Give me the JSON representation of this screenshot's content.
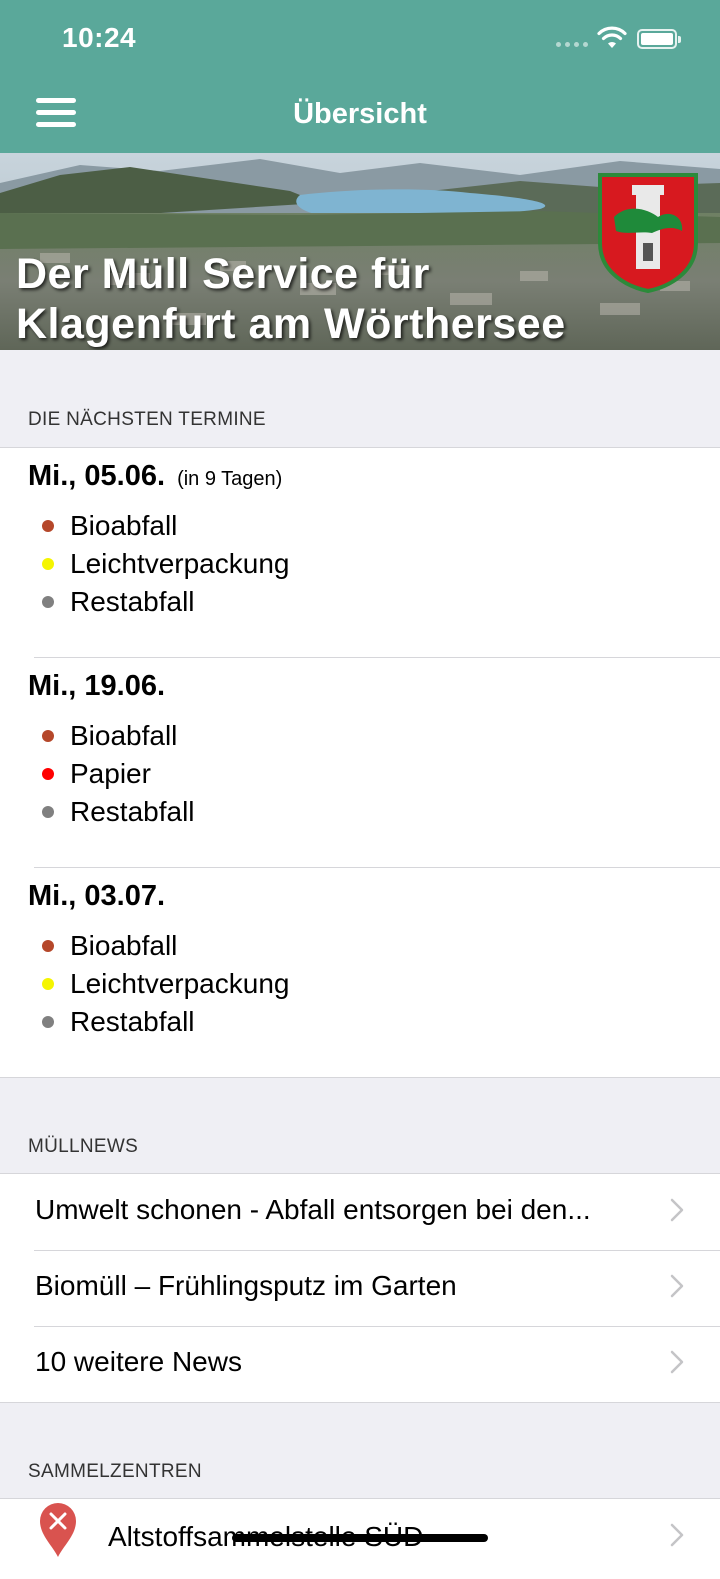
{
  "status_bar": {
    "time": "10:24"
  },
  "nav": {
    "title": "Übersicht",
    "menu_icon": "hamburger-menu-icon"
  },
  "banner": {
    "line1": "Der Müll Service für",
    "line2": "Klagenfurt am Wörthersee"
  },
  "colors": {
    "header": "#5aa89a",
    "bioabfall": "#b5472a",
    "leichtverpackung": "#f5f500",
    "restabfall": "#808080",
    "papier": "#ff0000"
  },
  "termine": {
    "header": "DIE NÄCHSTEN TERMINE",
    "dates": [
      {
        "date": "Mi., 05.06.",
        "relative": "(in 9 Tagen)",
        "items": [
          {
            "label": "Bioabfall",
            "color": "#b5472a"
          },
          {
            "label": "Leichtverpackung",
            "color": "#f5f500"
          },
          {
            "label": "Restabfall",
            "color": "#808080"
          }
        ]
      },
      {
        "date": "Mi., 19.06.",
        "relative": "",
        "items": [
          {
            "label": "Bioabfall",
            "color": "#b5472a"
          },
          {
            "label": "Papier",
            "color": "#ff0000"
          },
          {
            "label": "Restabfall",
            "color": "#808080"
          }
        ]
      },
      {
        "date": "Mi., 03.07.",
        "relative": "",
        "items": [
          {
            "label": "Bioabfall",
            "color": "#b5472a"
          },
          {
            "label": "Leichtverpackung",
            "color": "#f5f500"
          },
          {
            "label": "Restabfall",
            "color": "#808080"
          }
        ]
      }
    ]
  },
  "news": {
    "header": "MÜLLNEWS",
    "items": [
      {
        "label": "Umwelt schonen - Abfall entsorgen bei den..."
      },
      {
        "label": "Biomüll – Frühlingsputz im Garten"
      },
      {
        "label": "10 weitere News"
      }
    ]
  },
  "sammelzentren": {
    "header": "SAMMELZENTREN",
    "items": [
      {
        "label": "Altstoffsammelstelle SÜD",
        "icon": "map-pin-icon"
      }
    ]
  }
}
